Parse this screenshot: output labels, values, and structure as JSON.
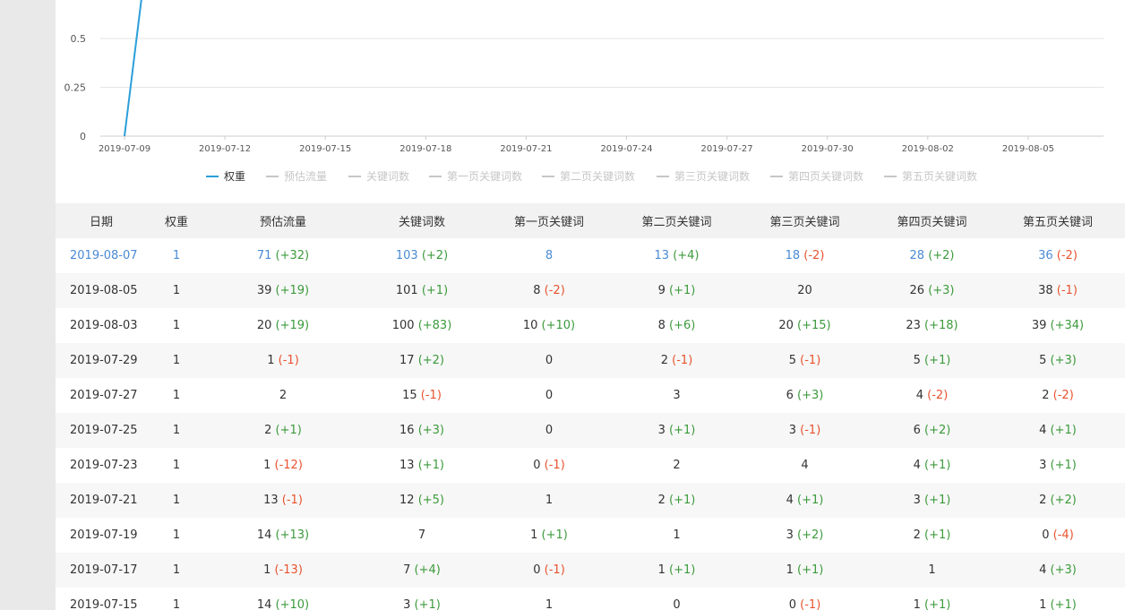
{
  "chart_data": {
    "type": "line",
    "x_tick_labels": [
      "2019-07-09",
      "2019-07-12",
      "2019-07-15",
      "2019-07-18",
      "2019-07-21",
      "2019-07-24",
      "2019-07-27",
      "2019-07-30",
      "2019-08-02",
      "2019-08-05"
    ],
    "y_tick_labels": [
      "0",
      "0.25",
      "0.5"
    ],
    "ylim": [
      0,
      0.5
    ],
    "grid": true,
    "series": [
      {
        "name": "权重",
        "color": "#2b9fd8",
        "visible": true,
        "points": [
          {
            "x": "2019-07-09",
            "y": 0
          }
        ]
      }
    ],
    "legend_position": "bottom-center"
  },
  "legend": [
    {
      "label": "权重",
      "active": true
    },
    {
      "label": "预估流量",
      "active": false
    },
    {
      "label": "关键词数",
      "active": false
    },
    {
      "label": "第一页关键词数",
      "active": false
    },
    {
      "label": "第二页关键词数",
      "active": false
    },
    {
      "label": "第三页关键词数",
      "active": false
    },
    {
      "label": "第四页关键词数",
      "active": false
    },
    {
      "label": "第五页关键词数",
      "active": false
    }
  ],
  "colors": {
    "accent": "#2b9fd8",
    "link": "#4a8ad4",
    "increase": "#3c9a3c",
    "decrease": "#e8532f",
    "legend_off": "#c6c6c6"
  },
  "table": {
    "headers": [
      "日期",
      "权重",
      "预估流量",
      "关键词数",
      "第一页关键词",
      "第二页关键词",
      "第三页关键词",
      "第四页关键词",
      "第五页关键词"
    ],
    "rows": [
      {
        "highlight": true,
        "cells": [
          {
            "v": "2019-08-07"
          },
          {
            "v": "1"
          },
          {
            "v": "71",
            "d": "(+32)"
          },
          {
            "v": "103",
            "d": "(+2)"
          },
          {
            "v": "8"
          },
          {
            "v": "13",
            "d": "(+4)"
          },
          {
            "v": "18",
            "d": "(-2)"
          },
          {
            "v": "28",
            "d": "(+2)"
          },
          {
            "v": "36",
            "d": "(-2)"
          }
        ]
      },
      {
        "cells": [
          {
            "v": "2019-08-05"
          },
          {
            "v": "1"
          },
          {
            "v": "39",
            "d": "(+19)"
          },
          {
            "v": "101",
            "d": "(+1)"
          },
          {
            "v": "8",
            "d": "(-2)"
          },
          {
            "v": "9",
            "d": "(+1)"
          },
          {
            "v": "20"
          },
          {
            "v": "26",
            "d": "(+3)"
          },
          {
            "v": "38",
            "d": "(-1)"
          }
        ]
      },
      {
        "cells": [
          {
            "v": "2019-08-03"
          },
          {
            "v": "1"
          },
          {
            "v": "20",
            "d": "(+19)"
          },
          {
            "v": "100",
            "d": "(+83)"
          },
          {
            "v": "10",
            "d": "(+10)"
          },
          {
            "v": "8",
            "d": "(+6)"
          },
          {
            "v": "20",
            "d": "(+15)"
          },
          {
            "v": "23",
            "d": "(+18)"
          },
          {
            "v": "39",
            "d": "(+34)"
          }
        ]
      },
      {
        "cells": [
          {
            "v": "2019-07-29"
          },
          {
            "v": "1"
          },
          {
            "v": "1",
            "d": "(-1)"
          },
          {
            "v": "17",
            "d": "(+2)"
          },
          {
            "v": "0"
          },
          {
            "v": "2",
            "d": "(-1)"
          },
          {
            "v": "5",
            "d": "(-1)"
          },
          {
            "v": "5",
            "d": "(+1)"
          },
          {
            "v": "5",
            "d": "(+3)"
          }
        ]
      },
      {
        "cells": [
          {
            "v": "2019-07-27"
          },
          {
            "v": "1"
          },
          {
            "v": "2"
          },
          {
            "v": "15",
            "d": "(-1)"
          },
          {
            "v": "0"
          },
          {
            "v": "3"
          },
          {
            "v": "6",
            "d": "(+3)"
          },
          {
            "v": "4",
            "d": "(-2)"
          },
          {
            "v": "2",
            "d": "(-2)"
          }
        ]
      },
      {
        "cells": [
          {
            "v": "2019-07-25"
          },
          {
            "v": "1"
          },
          {
            "v": "2",
            "d": "(+1)"
          },
          {
            "v": "16",
            "d": "(+3)"
          },
          {
            "v": "0"
          },
          {
            "v": "3",
            "d": "(+1)"
          },
          {
            "v": "3",
            "d": "(-1)"
          },
          {
            "v": "6",
            "d": "(+2)"
          },
          {
            "v": "4",
            "d": "(+1)"
          }
        ]
      },
      {
        "cells": [
          {
            "v": "2019-07-23"
          },
          {
            "v": "1"
          },
          {
            "v": "1",
            "d": "(-12)"
          },
          {
            "v": "13",
            "d": "(+1)"
          },
          {
            "v": "0",
            "d": "(-1)"
          },
          {
            "v": "2"
          },
          {
            "v": "4"
          },
          {
            "v": "4",
            "d": "(+1)"
          },
          {
            "v": "3",
            "d": "(+1)"
          }
        ]
      },
      {
        "cells": [
          {
            "v": "2019-07-21"
          },
          {
            "v": "1"
          },
          {
            "v": "13",
            "d": "(-1)"
          },
          {
            "v": "12",
            "d": "(+5)"
          },
          {
            "v": "1"
          },
          {
            "v": "2",
            "d": "(+1)"
          },
          {
            "v": "4",
            "d": "(+1)"
          },
          {
            "v": "3",
            "d": "(+1)"
          },
          {
            "v": "2",
            "d": "(+2)"
          }
        ]
      },
      {
        "cells": [
          {
            "v": "2019-07-19"
          },
          {
            "v": "1"
          },
          {
            "v": "14",
            "d": "(+13)"
          },
          {
            "v": "7"
          },
          {
            "v": "1",
            "d": "(+1)"
          },
          {
            "v": "1"
          },
          {
            "v": "3",
            "d": "(+2)"
          },
          {
            "v": "2",
            "d": "(+1)"
          },
          {
            "v": "0",
            "d": "(-4)"
          }
        ]
      },
      {
        "cells": [
          {
            "v": "2019-07-17"
          },
          {
            "v": "1"
          },
          {
            "v": "1",
            "d": "(-13)"
          },
          {
            "v": "7",
            "d": "(+4)"
          },
          {
            "v": "0",
            "d": "(-1)"
          },
          {
            "v": "1",
            "d": "(+1)"
          },
          {
            "v": "1",
            "d": "(+1)"
          },
          {
            "v": "1"
          },
          {
            "v": "4",
            "d": "(+3)"
          }
        ]
      },
      {
        "cells": [
          {
            "v": "2019-07-15"
          },
          {
            "v": "1"
          },
          {
            "v": "14",
            "d": "(+10)"
          },
          {
            "v": "3",
            "d": "(+1)"
          },
          {
            "v": "1"
          },
          {
            "v": "0"
          },
          {
            "v": "0",
            "d": "(-1)"
          },
          {
            "v": "1",
            "d": "(+1)"
          },
          {
            "v": "1",
            "d": "(+1)"
          }
        ]
      }
    ]
  }
}
